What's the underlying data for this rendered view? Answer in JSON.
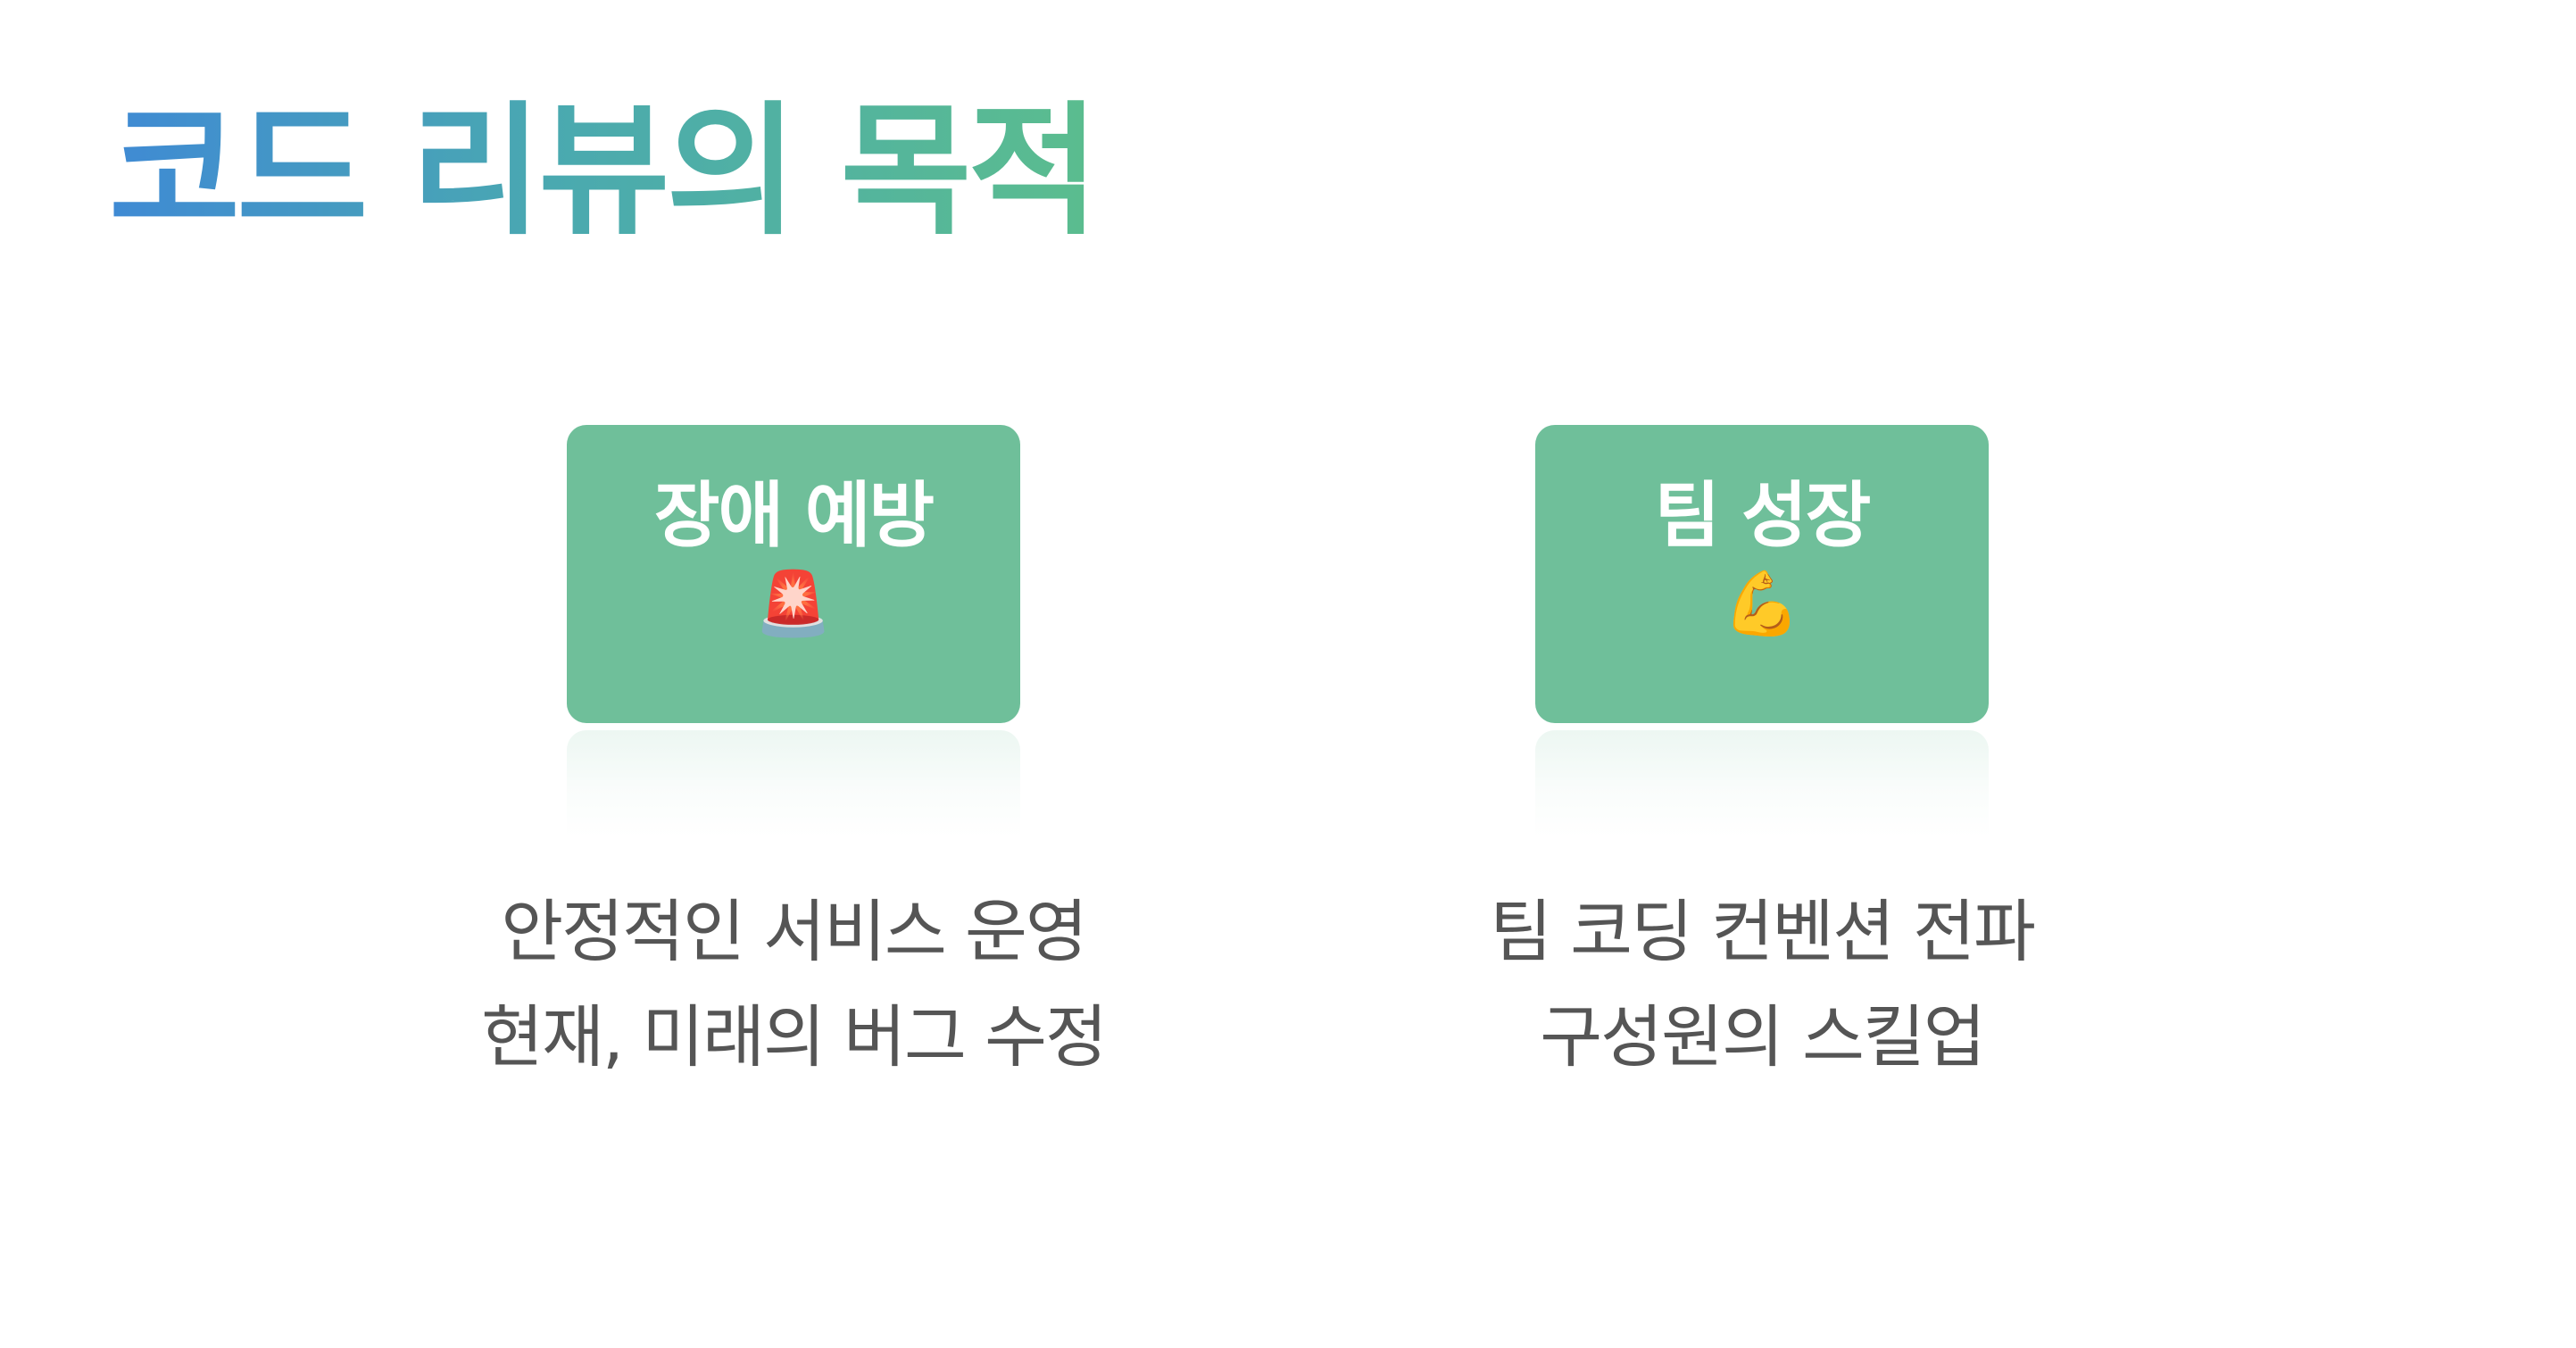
{
  "title": "코드 리뷰의 목적",
  "cards": [
    {
      "label": "장애 예방",
      "icon": "🚨",
      "icon_name": "police-light-icon",
      "desc": [
        "안정적인 서비스 운영",
        "현재, 미래의 버그 수정"
      ]
    },
    {
      "label": "팀 성장",
      "icon": "💪",
      "icon_name": "flexed-biceps-icon",
      "desc": [
        "팀 코딩 컨벤션 전파",
        "구성원의 스킬업"
      ]
    }
  ],
  "colors": {
    "card_background": "#6fbf9a",
    "title_gradient_start": "#3f8ad4",
    "title_gradient_end": "#5bbd8e",
    "description_text": "#555555"
  }
}
